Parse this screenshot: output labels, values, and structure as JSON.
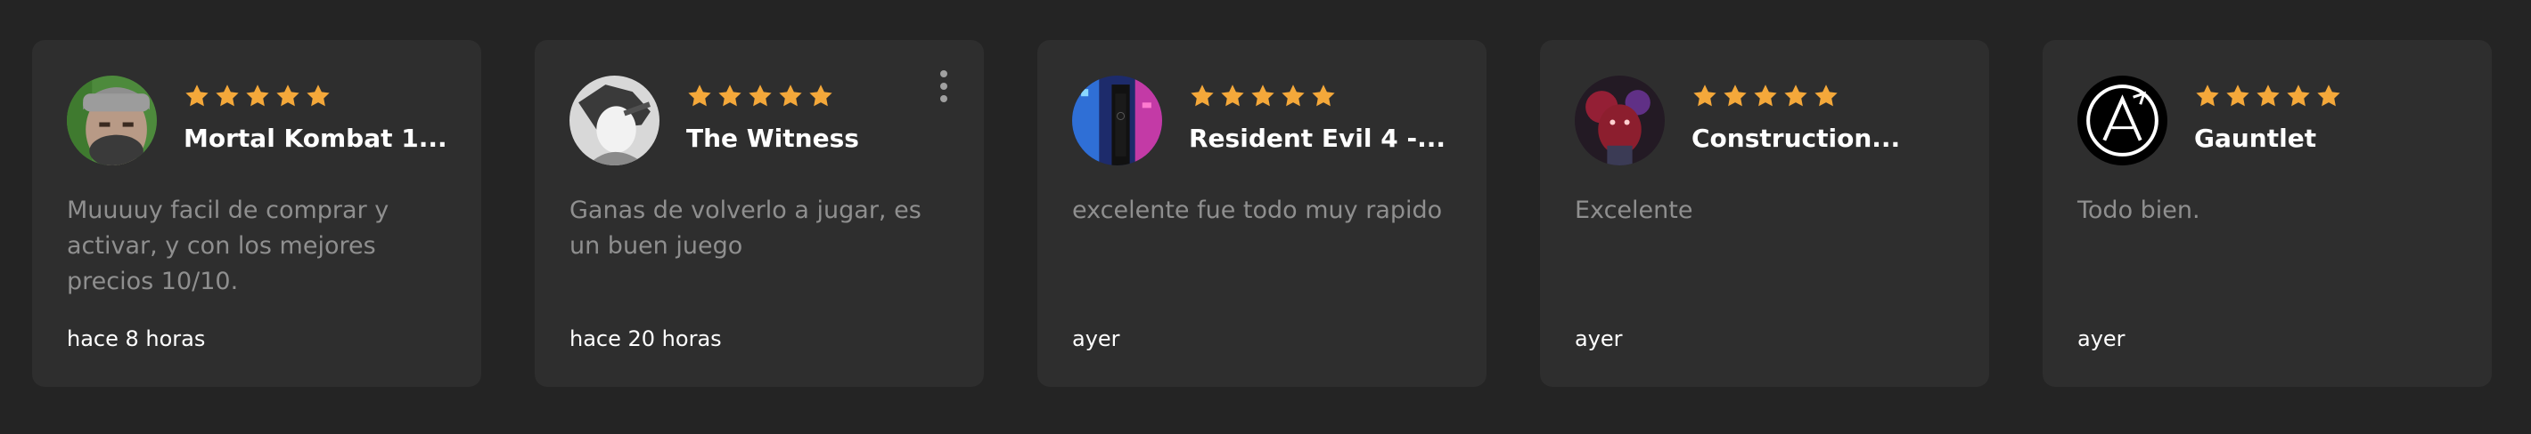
{
  "colors": {
    "background": "#242424",
    "card": "#2e2e2e",
    "star": "#f4a83a",
    "body_text": "#8f8f8f",
    "title_text": "#ffffff"
  },
  "reviews": [
    {
      "rating": 5,
      "title": "Mortal Kombat 1...",
      "text": "Muuuuy facil de comprar y activar, y con los mejores precios 10/10.",
      "time": "hace 8 horas",
      "avatar_icon": "bearded-man-avatar-icon"
    },
    {
      "rating": 5,
      "title": "The Witness",
      "text": "Ganas de volverlo a jugar, es un buen juego",
      "time": "hace 20 horas",
      "avatar_icon": "anime-character-avatar-icon",
      "has_menu": true,
      "menu_icon": "more-vertical-icon"
    },
    {
      "rating": 5,
      "title": "Resident Evil 4 -...",
      "text": "excelente fue todo muy rapido",
      "time": "ayer",
      "avatar_icon": "neon-city-avatar-icon"
    },
    {
      "rating": 5,
      "title": "Construction...",
      "text": "Excelente",
      "time": "ayer",
      "avatar_icon": "red-figure-avatar-icon"
    },
    {
      "rating": 5,
      "title": "Gauntlet",
      "text": "Todo bien.",
      "time": "ayer",
      "avatar_icon": "logo-a-avatar-icon"
    }
  ]
}
